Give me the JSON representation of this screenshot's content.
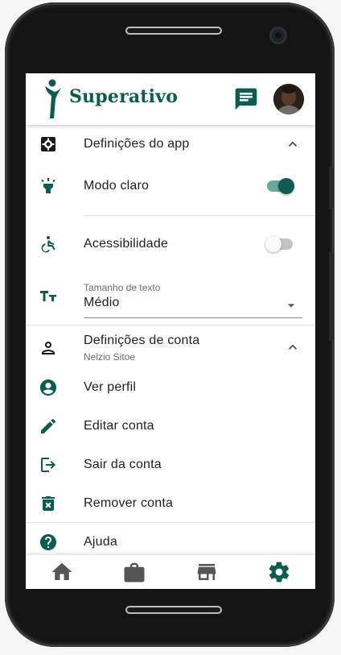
{
  "colors": {
    "primary": "#0d5c50",
    "icon": "#0d5c50",
    "text": "#1f1f1f",
    "muted": "#6b6b6b"
  },
  "app": {
    "brand": "Superativo",
    "chat_icon": "chat-icon",
    "avatar_icon": "user-avatar"
  },
  "settings": {
    "app_section": {
      "title": "Definições do app",
      "icon": "settings-icon",
      "expanded": true
    },
    "theme": {
      "label": "Modo claro",
      "icon": "lamp-icon",
      "enabled": true
    },
    "accessibility": {
      "label": "Acessibilidade",
      "icon": "accessible-icon",
      "enabled": false
    },
    "text_size": {
      "caption": "Tamanho de texto",
      "value": "Médio",
      "icon": "text-size-icon"
    },
    "account_section": {
      "title": "Definições de conta",
      "subtitle": "Nelzio Sitoe",
      "icon": "person-icon",
      "expanded": true
    },
    "account_items": [
      {
        "label": "Ver perfil",
        "icon": "account-circle-icon"
      },
      {
        "label": "Editar conta",
        "icon": "pencil-icon"
      },
      {
        "label": "Sair da conta",
        "icon": "logout-icon"
      },
      {
        "label": "Remover conta",
        "icon": "trash-icon"
      }
    ],
    "help": {
      "label": "Ajuda",
      "icon": "help-icon"
    }
  },
  "bottom_nav": [
    {
      "name": "home",
      "icon": "home-icon",
      "active": false
    },
    {
      "name": "work",
      "icon": "briefcase-icon",
      "active": false
    },
    {
      "name": "store",
      "icon": "store-icon",
      "active": false
    },
    {
      "name": "settings",
      "icon": "gear-icon",
      "active": true
    }
  ]
}
